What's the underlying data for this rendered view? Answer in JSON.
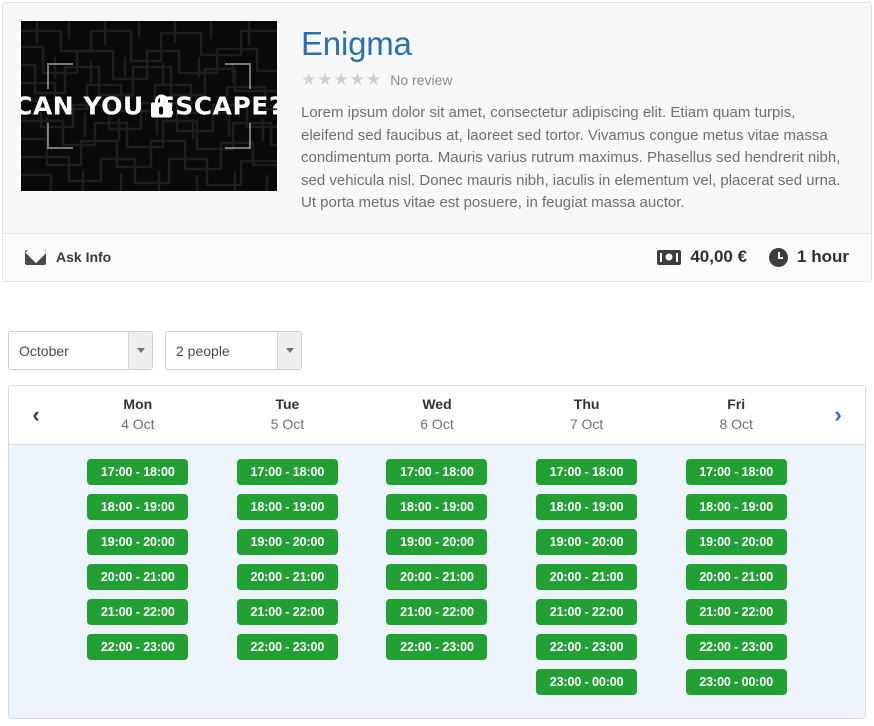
{
  "product": {
    "title": "Enigma",
    "poster": {
      "caption_before": "CAN YOU",
      "caption_after": "ESCAPE?",
      "icon": "lock-icon",
      "background_color": "#080808"
    },
    "rating": {
      "stars_total": 5,
      "stars_filled": 0,
      "star_glyph": "★",
      "review_text": "No review",
      "star_color": "#cfcfcf"
    },
    "description": "Lorem ipsum dolor sit amet, consectetur adipiscing elit. Etiam quam turpis, eleifend sed faucibus at, laoreet sed tortor. Vivamus congue metus vitae massa condimentum porta. Mauris varius rutrum maximus. Phasellus sed hendrerit nibh, sed vehicula nisl. Donec mauris nibh, iaculis in elementum vel, placerat sed urna. Ut porta metus vitae est posuere, in feugiat massa auctor.",
    "title_color": "#2a6fba"
  },
  "meta_bar": {
    "ask_info_label": "Ask Info",
    "ask_info_icon": "envelope-icon",
    "price": "40,00 €",
    "price_icon": "money-icon",
    "duration": "1 hour",
    "duration_icon": "clock-icon"
  },
  "filters": {
    "month": {
      "value": "October",
      "icon": "chevron-down-icon"
    },
    "people": {
      "value": "2 people",
      "icon": "chevron-down-icon"
    }
  },
  "calendar": {
    "prev_icon": "‹",
    "next_icon": "›",
    "slot_color": "#22a033",
    "body_background": "#eef4fb",
    "days": [
      {
        "name": "Mon",
        "date": "4 Oct",
        "slots": [
          "17:00 - 18:00",
          "18:00 - 19:00",
          "19:00 - 20:00",
          "20:00 - 21:00",
          "21:00 - 22:00",
          "22:00 - 23:00"
        ]
      },
      {
        "name": "Tue",
        "date": "5 Oct",
        "slots": [
          "17:00 - 18:00",
          "18:00 - 19:00",
          "19:00 - 20:00",
          "20:00 - 21:00",
          "21:00 - 22:00",
          "22:00 - 23:00"
        ]
      },
      {
        "name": "Wed",
        "date": "6 Oct",
        "slots": [
          "17:00 - 18:00",
          "18:00 - 19:00",
          "19:00 - 20:00",
          "20:00 - 21:00",
          "21:00 - 22:00",
          "22:00 - 23:00"
        ]
      },
      {
        "name": "Thu",
        "date": "7 Oct",
        "slots": [
          "17:00 - 18:00",
          "18:00 - 19:00",
          "19:00 - 20:00",
          "20:00 - 21:00",
          "21:00 - 22:00",
          "22:00 - 23:00",
          "23:00 - 00:00"
        ]
      },
      {
        "name": "Fri",
        "date": "8 Oct",
        "slots": [
          "17:00 - 18:00",
          "18:00 - 19:00",
          "19:00 - 20:00",
          "20:00 - 21:00",
          "21:00 - 22:00",
          "22:00 - 23:00",
          "23:00 - 00:00"
        ]
      }
    ]
  }
}
